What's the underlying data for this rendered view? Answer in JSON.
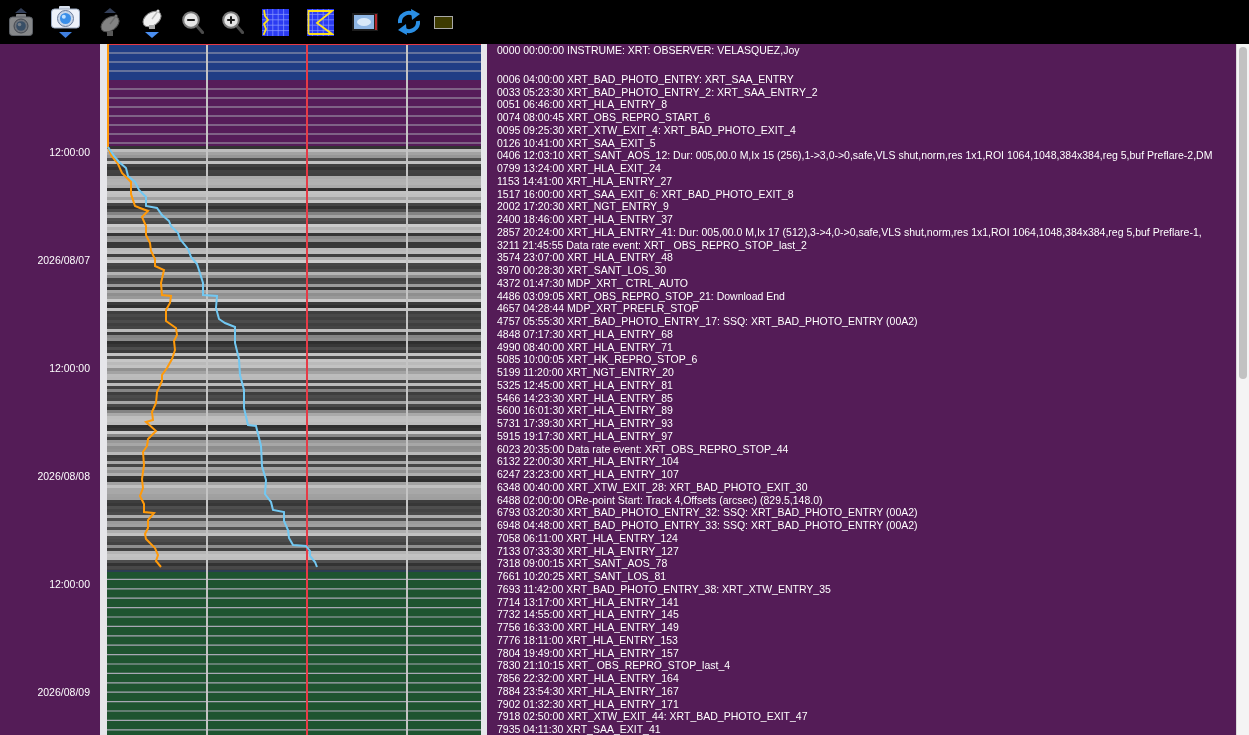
{
  "toolbar": [
    {
      "kind": "camera-up",
      "disabled": true
    },
    {
      "kind": "camera-down",
      "disabled": false
    },
    {
      "kind": "dish-up",
      "disabled": true
    },
    {
      "kind": "dish-down",
      "disabled": false
    },
    {
      "kind": "zoom-out",
      "disabled": false
    },
    {
      "kind": "zoom-in",
      "disabled": false
    },
    {
      "kind": "grid-plot",
      "disabled": false
    },
    {
      "kind": "zigzag-plot",
      "disabled": false
    },
    {
      "kind": "image",
      "disabled": false
    },
    {
      "kind": "refresh",
      "disabled": false
    },
    {
      "kind": "swatch",
      "disabled": false,
      "color": "#3d3a00"
    }
  ],
  "time_axis": {
    "labels": [
      "12:00:00",
      "2026/08/07",
      "12:00:00",
      "2026/08/08",
      "12:00:00",
      "2026/08/09"
    ]
  },
  "events": [
    "0000 00:00:00 INSTRUME: XRT: OBSERVER: VELASQUEZ,Joy",
    "0006 04:00:00 XRT_BAD_PHOTO_ENTRY: XRT_SAA_ENTRY",
    "0033 05:23:30 XRT_BAD_PHOTO_ENTRY_2: XRT_SAA_ENTRY_2",
    "0051 06:46:00 XRT_HLA_ENTRY_8",
    "0074 08:00:45 XRT_OBS_REPRO_START_6",
    "0095 09:25:30 XRT_XTW_EXIT_4: XRT_BAD_PHOTO_EXIT_4",
    "0126 10:41:00 XRT_SAA_EXIT_5",
    "0406 12:03:10 XRT_SANT_AOS_12: Dur: 005,00.0 M,Ix 15 (256),1->3,0->0,safe,VLS shut,norm,res 1x1,ROI 1064,1048,384x384,reg 5,buf Preflare-2,DM",
    "0799 13:24:00 XRT_HLA_EXIT_24",
    "1153 14:41:00 XRT_HLA_ENTRY_27",
    "1517 16:00:00 XRT_SAA_EXIT_6: XRT_BAD_PHOTO_EXIT_8",
    "2002 17:20:30 XRT_NGT_ENTRY_9",
    "2400 18:46:00 XRT_HLA_ENTRY_37",
    "2857 20:24:00 XRT_HLA_ENTRY_41: Dur: 005,00.0 M,Ix 17 (512),3->4,0->0,safe,VLS shut,norm,res 1x1,ROI 1064,1048,384x384,reg 5,buf Preflare-1,",
    "3211 21:45:55 Data rate event: XRT_ OBS_REPRO_STOP_last_2",
    "3574 23:07:00 XRT_HLA_ENTRY_48",
    "3970 00:28:30 XRT_SANT_LOS_30",
    "4372 01:47:30 MDP_XRT_ CTRL_AUTO",
    "4486 03:09:05 XRT_OBS_REPRO_STOP_21: Download End",
    "4657 04:28:44 MDP_XRT_PREFLR_STOP",
    "4757 05:55:30 XRT_BAD_PHOTO_ENTRY_17: SSQ: XRT_BAD_PHOTO_ENTRY (00A2)",
    "4848 07:17:30 XRT_HLA_ENTRY_68",
    "4990 08:40:00 XRT_HLA_ENTRY_71",
    "5085 10:00:05 XRT_HK_REPRO_STOP_6",
    "5199 11:20:00 XRT_NGT_ENTRY_20",
    "5325 12:45:00 XRT_HLA_ENTRY_81",
    "5466 14:23:30 XRT_HLA_ENTRY_85",
    "5600 16:01:30 XRT_HLA_ENTRY_89",
    "5731 17:39:30 XRT_HLA_ENTRY_93",
    "5915 19:17:30 XRT_HLA_ENTRY_97",
    "6023 20:35:00 Data rate event: XRT_OBS_REPRO_STOP_44",
    "6132 22:00:30 XRT_HLA_ENTRY_104",
    "6247 23:23:00 XRT_HLA_ENTRY_107",
    "6348 00:40:00 XRT_XTW_EXIT_28: XRT_BAD_PHOTO_EXIT_30",
    "6488 02:00:00 ORe-point Start: Track 4,Offsets (arcsec) (829.5,148.0)",
    "6793 03:20:30 XRT_BAD_PHOTO_ENTRY_32: SSQ: XRT_BAD_PHOTO_ENTRY (00A2)",
    "6948 04:48:00 XRT_BAD_PHOTO_ENTRY_33: SSQ: XRT_BAD_PHOTO_ENTRY (00A2)",
    "7058 06:11:00 XRT_HLA_ENTRY_124",
    "7133 07:33:30 XRT_HLA_ENTRY_127",
    "7318 09:00:15 XRT_SANT_AOS_78",
    "7661 10:20:25 XRT_SANT_LOS_81",
    "7693 11:42:00 XRT_BAD_PHOTO_ENTRY_38: XRT_XTW_ENTRY_35",
    "7714 13:17:00 XRT_HLA_ENTRY_141",
    "7732 14:55:00 XRT_HLA_ENTRY_145",
    "7756 16:33:00 XRT_HLA_ENTRY_149",
    "7776 18:11:00 XRT_HLA_ENTRY_153",
    "7804 19:49:00 XRT_HLA_ENTRY_157",
    "7830 21:10:15 XRT_ OBS_REPRO_STOP_last_4",
    "7856 22:32:00 XRT_HLA_ENTRY_164",
    "7884 23:54:30 XRT_HLA_ENTRY_167",
    "7902 01:32:30 XRT_HLA_ENTRY_171",
    "7918 02:50:00 XRT_XTW_EXIT_44: XRT_BAD_PHOTO_EXIT_47",
    "7935 04:11:30 XRT_SAA_EXIT_41"
  ]
}
